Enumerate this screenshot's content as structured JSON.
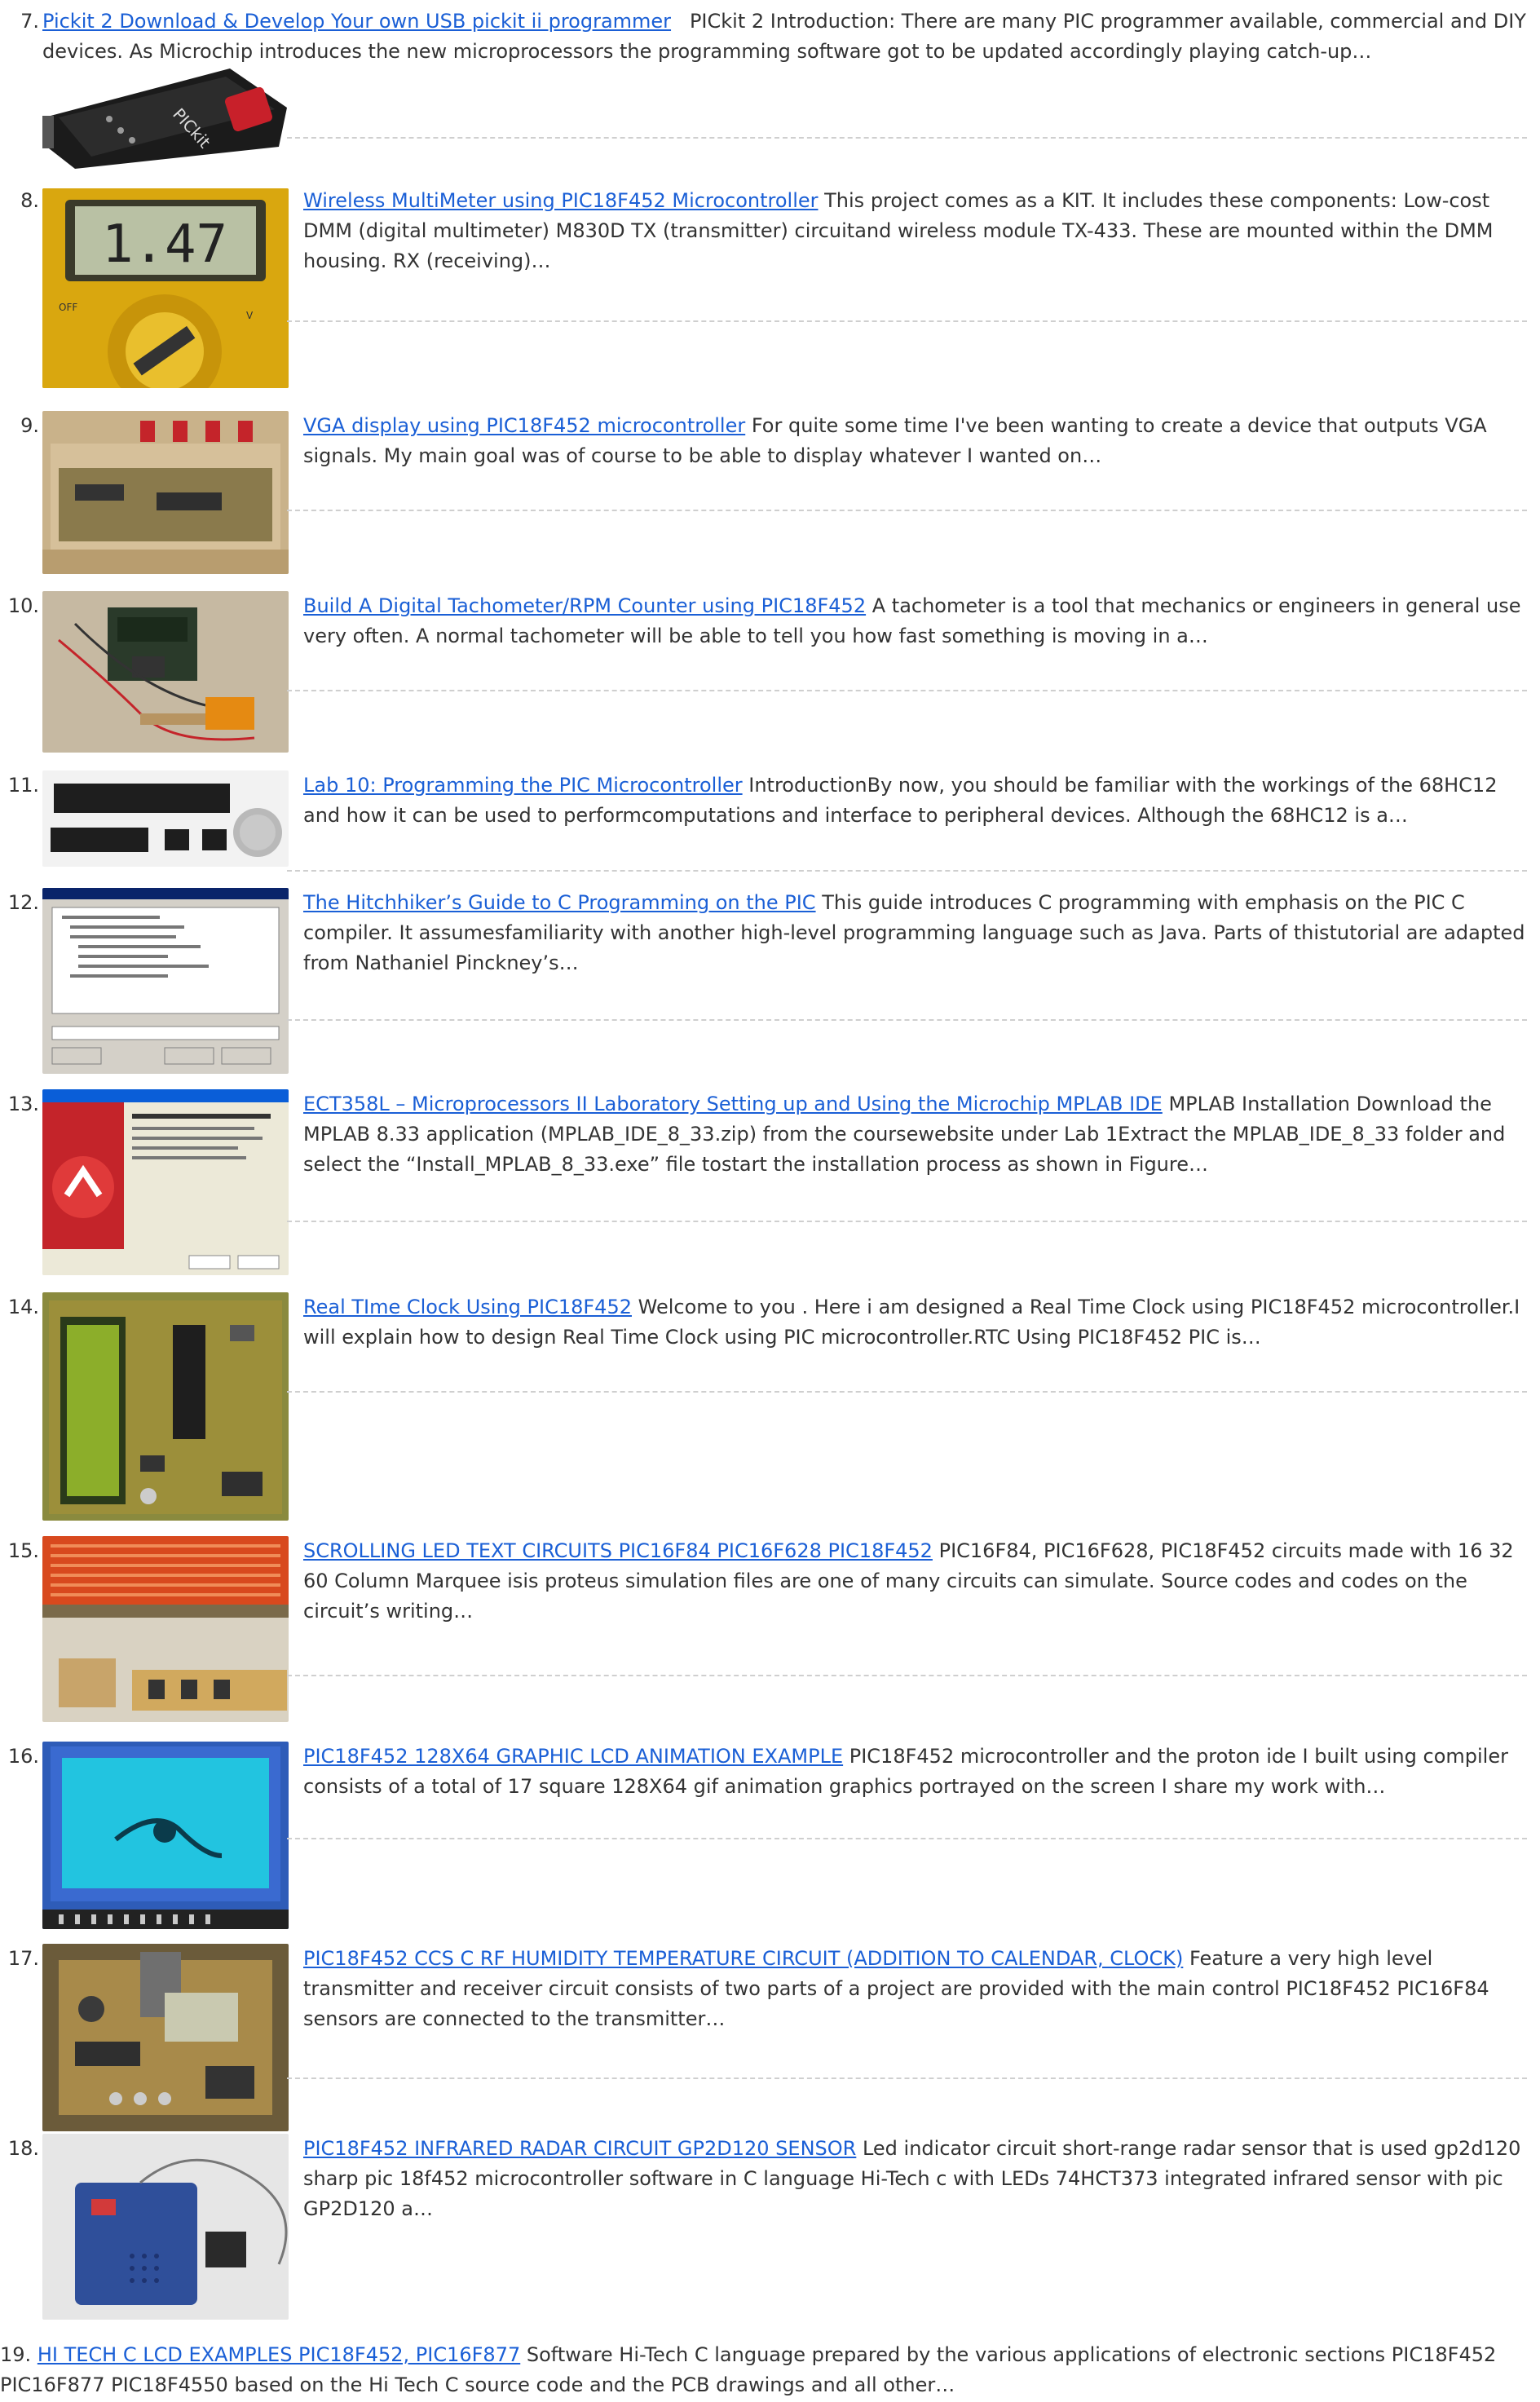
{
  "items": [
    {
      "number": "7.",
      "title": "Pickit 2 Download & Develop Your own USB pickit ii programmer",
      "excerpt": "PICkit 2 Introduction: There are many PIC programmer available, commercial and DIY devices. As Microchip introduces the new microprocessors the programming software got to be updated accordingly playing catch-up…",
      "thumb_icon": "pickit-programmer-photo",
      "thumb_text": "PICkit"
    },
    {
      "number": "8.",
      "title": "Wireless MultiMeter using PIC18F452 Microcontroller",
      "excerpt": "This project comes as a KIT. It includes these components: Low-cost DMM (digital multimeter) M830D TX (transmitter) circuitand  wireless module TX-433. These are mounted within the DMM housing. RX (receiving)…",
      "thumb_icon": "multimeter-photo",
      "thumb_text": "1.47"
    },
    {
      "number": "9.",
      "title": "VGA display using PIC18F452 microcontroller",
      "excerpt": "For quite some time I've been wanting to create a device that outputs VGA signals. My main goal was of course to be able to display whatever I wanted on…",
      "thumb_icon": "vga-board-photo"
    },
    {
      "number": "10.",
      "title": "Build A Digital Tachometer/RPM Counter using PIC18F452",
      "excerpt": "A tachometer is a tool that mechanics or engineers in general use very often. A normal tachometer will be able to tell you how fast something is moving in a…",
      "thumb_icon": "tachometer-circuit-photo"
    },
    {
      "number": "11.",
      "title": "Lab 10: Programming the PIC Microcontroller",
      "excerpt": "IntroductionBy now, you should be familiar with the workings of the 68HC12 and how it can be used to performcomputations and interface to peripheral devices. Although the 68HC12 is a…",
      "thumb_icon": "pic-chips-photo"
    },
    {
      "number": "12.",
      "title": "The Hitchhiker’s Guide to C Programming on the PIC",
      "excerpt": "This guide introduces C programming with emphasis on the PIC C compiler. It assumesfamiliarity with another high-level programming language such as Java. Parts of thistutorial are adapted from Nathaniel Pinckney’s…",
      "thumb_icon": "dialog-screenshot"
    },
    {
      "number": "13.",
      "title": "ECT358L – Microprocessors II Laboratory Setting up and Using the Microchip MPLAB IDE",
      "excerpt": "MPLAB Installation Download the MPLAB 8.33 application (MPLAB_IDE_8_33.zip) from the coursewebsite under Lab 1Extract the MPLAB_IDE_8_33 folder and select the “Install_MPLAB_8_33.exe” file tostart the installation process as shown in Figure…",
      "thumb_icon": "installer-screenshot"
    },
    {
      "number": "14.",
      "title": "Real TIme Clock Using PIC18F452",
      "excerpt": "Welcome to you . Here i am designed a Real Time Clock using PIC18F452 microcontroller.I will explain how to design Real Time Clock using PIC microcontroller.RTC Using PIC18F452 PIC is…",
      "thumb_icon": "rtc-board-photo"
    },
    {
      "number": "15.",
      "title": "SCROLLING LED TEXT CIRCUITS PIC16F84 PIC16F628 PIC18F452",
      "excerpt": "PIC16F84, PIC16F628, PIC18F452 circuits made with 16 32 60 Column Marquee isis proteus simulation files are one of many circuits can simulate. Source codes and codes on the circuit’s writing…",
      "thumb_icon": "led-matrix-photo"
    },
    {
      "number": "16.",
      "title": "PIC18F452 128X64 GRAPHIC LCD ANIMATION EXAMPLE",
      "excerpt": "PIC18F452 microcontroller and the proton ide I built using compiler consists of a total of 17 square 128X64 gif animation graphics portrayed on the screen I share my work with…",
      "thumb_icon": "graphic-lcd-photo"
    },
    {
      "number": "17.",
      "title": "PIC18F452 CCS C RF HUMIDITY TEMPERATURE CIRCUIT (ADDITION TO CALENDAR, CLOCK)",
      "excerpt": "Feature a very high level transmitter and receiver circuit consists of two parts of a project are provided with the main control PIC18F452 PIC16F84 sensors are connected to the transmitter…",
      "thumb_icon": "rf-circuit-photo"
    },
    {
      "number": "18.",
      "title": "PIC18F452 INFRARED RADAR CIRCUIT GP2D120 SENSOR",
      "excerpt": "Led indicator circuit short-range radar sensor that is used gp2d120 sharp pic 18f452 microcontroller software in C language Hi-Tech c with LEDs 74HCT373 integrated infrared sensor with pic GP2D120 a…",
      "thumb_icon": "radar-box-photo"
    },
    {
      "number": "19.",
      "title": "HI TECH C LCD EXAMPLES PIC18F452, PIC16F877",
      "excerpt": "Software Hi-Tech C language prepared by the various applications of electronic sections PIC18F452 PIC16F877 PIC18F4550 based on the Hi Tech C source code and the PCB drawings and all other…"
    }
  ]
}
